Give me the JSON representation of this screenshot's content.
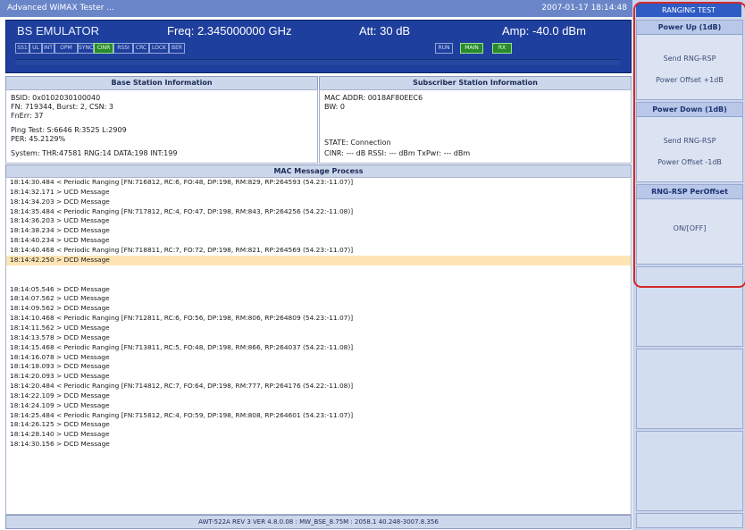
{
  "window": {
    "title": "Advanced WiMAX Tester ...",
    "timestamp": "2007-01-17 18:14:48"
  },
  "header": {
    "bs_name": "BS EMULATOR",
    "freq": "Freq: 2.345000000 GHz",
    "att": "Att: 30 dB",
    "amp": "Amp: -40.0 dBm",
    "indicators": [
      "SS1",
      "UL",
      "INT",
      "OPM",
      "SYNC",
      "CINR",
      "RSSI",
      "CRC",
      "LOCK",
      "BER",
      "RUN",
      "MAIN",
      "RX"
    ],
    "indicators_on": [
      "CINR",
      "MAIN",
      "RX"
    ]
  },
  "bs_info": {
    "title": "Base Station Information",
    "lines": [
      "BSID: 0x0102030100040",
      "FN: 719344, Burst: 2, CSN: 3",
      "FnErr: 37",
      "Ping Test: S:6646 R:3525 L:2909",
      "PER: 45.2129%",
      "System: THR:47581 RNG:14 DATA:198 INT:199"
    ]
  },
  "ss_info": {
    "title": "Subscriber Station Information",
    "lines": [
      "MAC ADDR: 0018AF80EEC6",
      "BW: 0",
      "STATE: Connection",
      "CINR: --- dB    RSSI: --- dBm    TxPwr: --- dBm"
    ]
  },
  "mac": {
    "title": "MAC Message Process",
    "lines": [
      "18:14:30.484 < Periodic Ranging [FN:716812, RC:6, FO:48, DP:198, RM:829, RP:264593 (54.23:-11.07)]",
      "18:14:32.171 > UCD Message",
      "18:14:34.203 > DCD Message",
      "18:14:35.484 < Periodic Ranging [FN:717812, RC:4, FO:47, DP:198, RM:843, RP:264256 (54.22:-11.08)]",
      "18:14:36.203 > UCD Message",
      "18:14:38.234 > DCD Message",
      "18:14:40.234 > UCD Message",
      "18:14:40.468 < Periodic Ranging [FN:718811, RC:7, FO:72, DP:198, RM:821, RP:264569 (54.23:-11.07)]",
      "18:14:42.250 > DCD Message",
      "",
      "18:14:05.546 > DCD Message",
      "18:14:07.562 > UCD Message",
      "18:14:09.562 > DCD Message",
      "18:14:10.468 < Periodic Ranging [FN:712811, RC:6, FO:56, DP:198, RM:806, RP:264809 (54.23:-11.07)]",
      "18:14:11.562 > UCD Message",
      "18:14:13.578 > DCD Message",
      "18:14:15.468 < Periodic Ranging [FN:713811, RC:5, FO:48, DP:198, RM:866, RP:264037 (54.22:-11.08)]",
      "18:14:16.078 > UCD Message",
      "18:14:18.093 > DCD Message",
      "18:14:20.093 > UCD Message",
      "18:14:20.484 < Periodic Ranging [FN:714812, RC:7, FO:64, DP:198, RM:777, RP:264176 (54.22:-11.08)]",
      "18:14:22.109 > DCD Message",
      "18:14:24.109 > UCD Message",
      "18:14:25.484 < Periodic Ranging [FN:715812, RC:4, FO:59, DP:198, RM:808, RP:264601 (54.23:-11.07)]",
      "18:14:26.125 > DCD Message",
      "18:14:28.140 > UCD Message",
      "18:14:30.156 > DCD Message"
    ],
    "selected_index": 8
  },
  "footer": {
    "text": "AWT-522A REV 3 VER 4.8.0.08 : MW_BSE_8.75M : 2058.1 40.248-3007.8.356"
  },
  "side": {
    "header": "RANGING TEST",
    "power_up": {
      "title": "Power Up (1dB)",
      "line1": "Send RNG-RSP",
      "line2": "Power Offset +1dB"
    },
    "power_down": {
      "title": "Power Down (1dB)",
      "line1": "Send RNG-RSP",
      "line2": "Power Offset -1dB"
    },
    "perioffset": {
      "title": "RNG-RSP PerOffset",
      "line1": "ON/[OFF]"
    }
  },
  "colors": {
    "header_bg": "#1f3f9e",
    "highlight_ring": "#d42a2a",
    "selected_row": "#fde4b5",
    "indicator_on": "#2a8a2a"
  }
}
